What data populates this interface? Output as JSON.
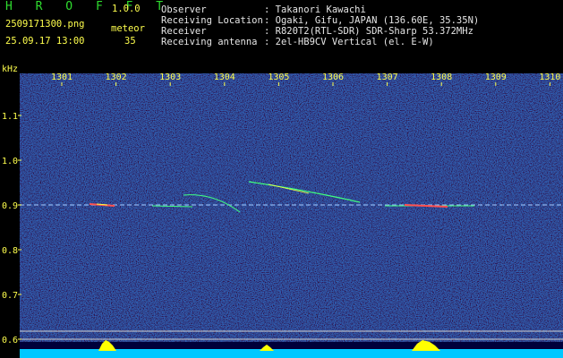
{
  "app": {
    "name": "H R O F F T",
    "version": "1.0.0"
  },
  "file": {
    "name": "2509171300.png",
    "datetime": "25.09.17 13:00"
  },
  "meteor": {
    "label": "meteor",
    "count": "35"
  },
  "info": [
    {
      "key": "Observer",
      "value": ": Takanori Kawachi"
    },
    {
      "key": "Receiving Location",
      "value": ": Ogaki, Gifu, JAPAN (136.60E, 35.35N)"
    },
    {
      "key": "Receiver",
      "value": ": R820T2(RTL-SDR) SDR-Sharp 53.372MHz"
    },
    {
      "key": "Receiving antenna",
      "value": ": 2el-HB9CV Vertical (el. E-W)"
    }
  ],
  "chart_data": {
    "type": "heatmap",
    "yunit": "kHz",
    "x_ticks": [
      "1301",
      "1302",
      "1303",
      "1304",
      "1305",
      "1306",
      "1307",
      "1308",
      "1309",
      "1310"
    ],
    "y_ticks": [
      "1.1",
      "1.0",
      "0.9",
      "0.8",
      "0.7",
      "0.6"
    ],
    "carrier_khz": 0.9,
    "meteor_count": 35,
    "colors": {
      "background": "#00003a",
      "carrier": "#ffffff",
      "strong": "#ff4040",
      "medium": "#ffff40",
      "weak": "#40ff80",
      "baseline": "#00c8ff",
      "peaks": "#ffff00"
    }
  }
}
